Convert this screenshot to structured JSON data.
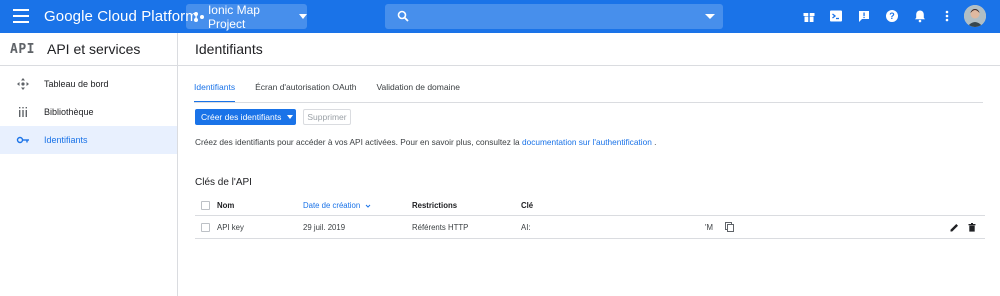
{
  "topbar": {
    "brand": "Google Cloud Platform",
    "project": "Ionic Map Project",
    "search_placeholder": "",
    "accent": "#1a73e8"
  },
  "sidebar": {
    "logo": "API",
    "title": "API et services",
    "items": [
      {
        "label": "Tableau de bord",
        "icon": "dashboard-icon"
      },
      {
        "label": "Bibliothèque",
        "icon": "library-icon"
      },
      {
        "label": "Identifiants",
        "icon": "key-icon"
      }
    ]
  },
  "main": {
    "title": "Identifiants",
    "tabs": [
      {
        "label": "Identifiants"
      },
      {
        "label": "Écran d'autorisation OAuth"
      },
      {
        "label": "Validation de domaine"
      }
    ],
    "create_button": "Créer des identifiants",
    "delete_button": "Supprimer",
    "description": "Créez des identifiants pour accéder à vos API activées. Pour en savoir plus, consultez la",
    "description_link": "documentation sur l'authentification",
    "description_end": ".",
    "section_title": "Clés de l'API",
    "table": {
      "headers": {
        "name": "Nom",
        "date": "Date de création",
        "restrictions": "Restrictions",
        "key": "Clé"
      },
      "rows": [
        {
          "name": "API key",
          "date": "29 juil. 2019",
          "restrictions": "Référents HTTP",
          "key_start": "AI:",
          "key_end": "'M"
        }
      ]
    }
  }
}
